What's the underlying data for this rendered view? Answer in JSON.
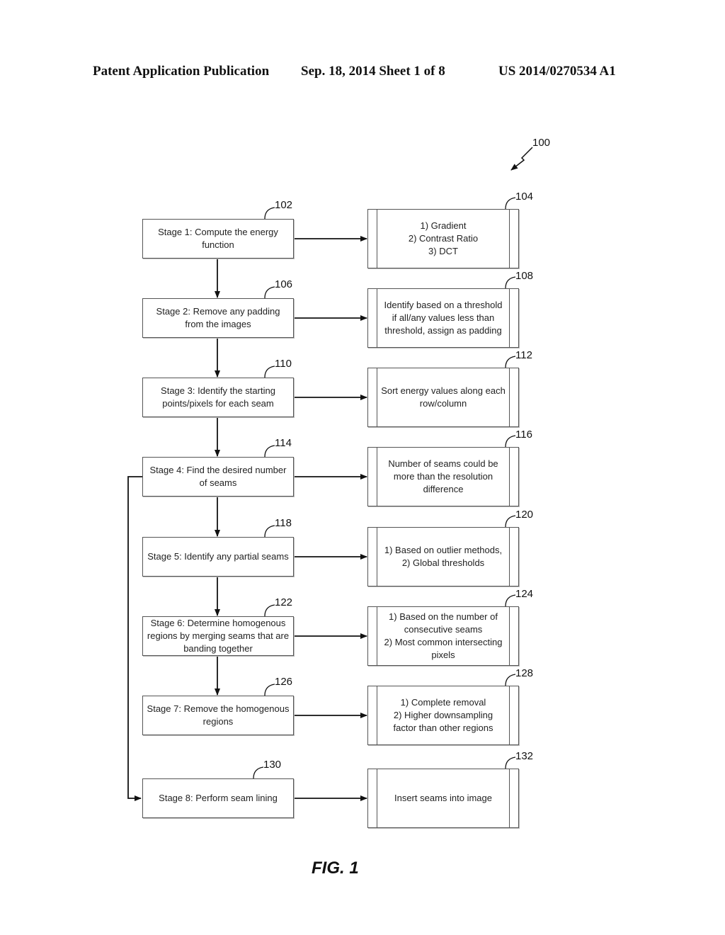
{
  "header": {
    "left": "Patent Application Publication",
    "middle": "Sep. 18, 2014   Sheet 1 of 8",
    "right": "US 2014/0270534 A1"
  },
  "figure_ref": "100",
  "stages": [
    {
      "ref": "102",
      "text": "Stage 1: Compute the energy\nfunction"
    },
    {
      "ref": "106",
      "text": "Stage 2: Remove any padding\nfrom the images"
    },
    {
      "ref": "110",
      "text": "Stage 3: Identify the starting\npoints/pixels for each seam"
    },
    {
      "ref": "114",
      "text": "Stage 4: Find the desired number\nof seams"
    },
    {
      "ref": "118",
      "text": "Stage 5: Identify any partial seams"
    },
    {
      "ref": "122",
      "text": "Stage 6: Determine homogenous\nregions by merging seams that are\nbanding together"
    },
    {
      "ref": "126",
      "text": "Stage 7: Remove the homogenous\nregions"
    },
    {
      "ref": "130",
      "text": "Stage 8: Perform seam lining"
    }
  ],
  "details": [
    {
      "ref": "104",
      "text": "1) Gradient\n2) Contrast Ratio\n3) DCT"
    },
    {
      "ref": "108",
      "text": "Identify based on a threshold\nif all/any values less than\nthreshold, assign as padding"
    },
    {
      "ref": "112",
      "text": "Sort energy values along each\nrow/column"
    },
    {
      "ref": "116",
      "text": "Number of seams could be\nmore than the resolution\ndifference"
    },
    {
      "ref": "120",
      "text": "1) Based on outlier methods,\n2) Global thresholds"
    },
    {
      "ref": "124",
      "text": "1) Based on the number of\nconsecutive seams\n2) Most common intersecting\npixels"
    },
    {
      "ref": "128",
      "text": "1) Complete removal\n2) Higher downsampling\nfactor than other regions"
    },
    {
      "ref": "132",
      "text": "Insert seams into image"
    }
  ],
  "caption": "FIG. 1"
}
